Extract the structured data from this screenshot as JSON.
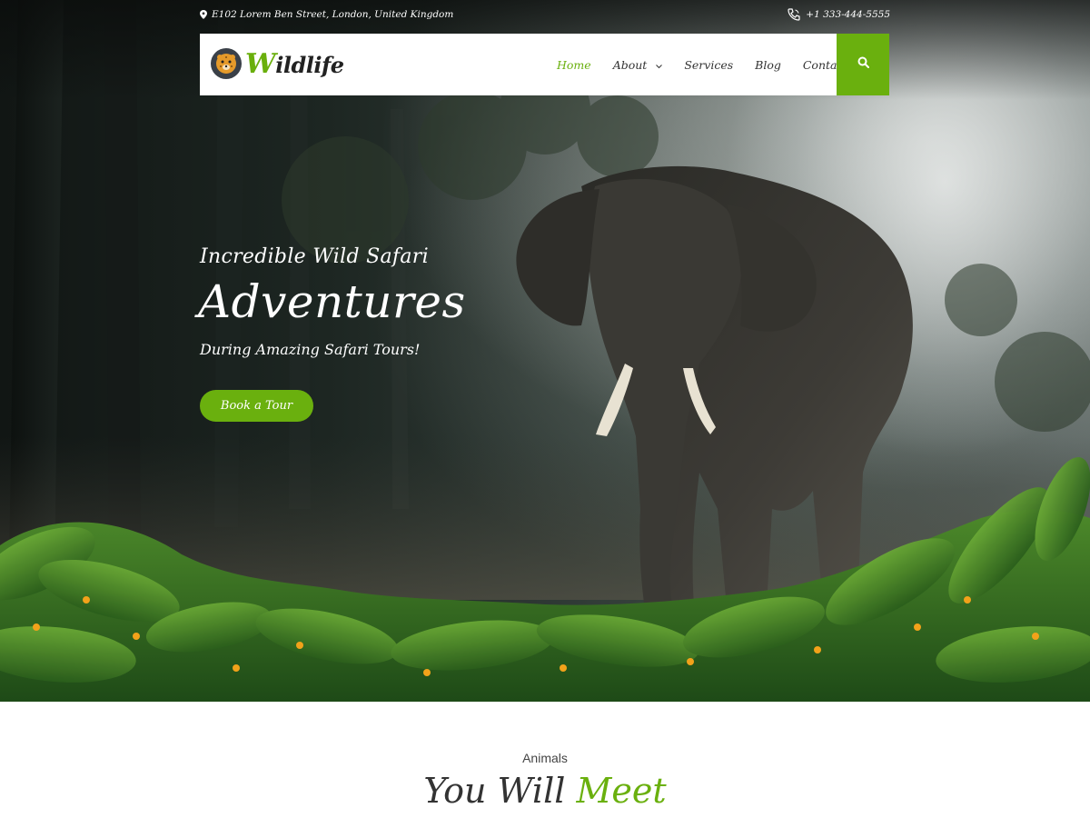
{
  "topbar": {
    "address": "E102 Lorem Ben Street, London, United Kingdom",
    "phone": "+1 333-444-5555"
  },
  "brand": {
    "logo_text_rest": "ildlife",
    "logo_text_initial": "W",
    "accent_color": "#6ab00e"
  },
  "nav": {
    "items": [
      {
        "label": "Home",
        "active": true
      },
      {
        "label": "About",
        "has_dropdown": true
      },
      {
        "label": "Services"
      },
      {
        "label": "Blog"
      },
      {
        "label": "Contact"
      }
    ],
    "search_icon": "search-icon"
  },
  "hero": {
    "subtitle": "Incredible Wild Safari",
    "title": "Adventures",
    "tagline": "During Amazing Safari Tours!",
    "cta": "Book a Tour"
  },
  "animals": {
    "label": "Animals",
    "title_part1": "You Will",
    "title_part2": "Meet"
  }
}
